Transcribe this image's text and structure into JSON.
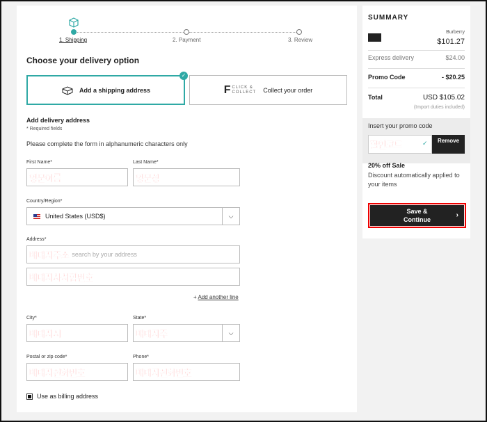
{
  "stepper": {
    "steps": [
      "1. Shipping",
      "2. Payment",
      "3. Review"
    ]
  },
  "delivery": {
    "title": "Choose your delivery option",
    "option_shipping": "Add a shipping address",
    "cc_logo_line1": "CLICK &",
    "cc_logo_line2": "COLLECT",
    "option_collect": "Collect your order"
  },
  "form": {
    "section_title": "Add delivery address",
    "required_note": "* Required fields",
    "hint": "Please complete the form in alphanumeric characters only",
    "first_name_label": "First Name",
    "first_name_value": "영문이름",
    "last_name_label": "Last Name",
    "last_name_value": "영문성",
    "country_label": "Country/Region",
    "country_value": "United States (USD$)",
    "address_label": "Address",
    "address_value": "배대지주소",
    "address_placeholder": "search by your address",
    "address2_value": "배대지사서함번호",
    "add_line": "Add another line",
    "city_label": "City",
    "city_value": "배대지시",
    "state_label": "State",
    "state_value": "배대지주",
    "postal_label": "Postal or zip code",
    "postal_value": "배대지전화번호",
    "phone_label": "Phone",
    "phone_value": "배대지전화번호",
    "billing_label": "Use as billing address"
  },
  "summary": {
    "title": "SUMMARY",
    "brand": "Burberry",
    "item_price": "$101.27",
    "express_label": "Express delivery",
    "express_value": "$24.00",
    "promo_label": "Promo Code",
    "promo_value": "- $20.25",
    "total_label": "Total",
    "total_value": "USD $105.02",
    "duty_note": "(Import duties included)",
    "promo_input_label": "Insert your promo code",
    "promo_input_value": "할인코드",
    "remove_label": "Remove",
    "sale_title": "20% off Sale",
    "sale_desc": "Discount automatically applied to your items",
    "save_label_1": "Save &",
    "save_label_2": "Continue"
  },
  "colors": {
    "accent": "#2fa9a5",
    "highlight": "#ff2020",
    "dark": "#222222"
  }
}
